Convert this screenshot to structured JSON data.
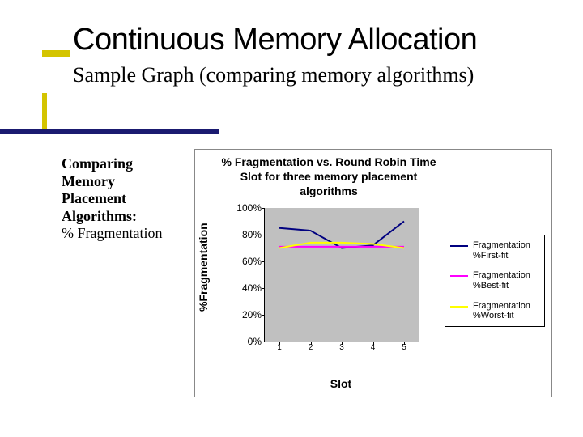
{
  "title": "Continuous Memory Allocation",
  "subtitle": "Sample Graph (comparing memory algorithms)",
  "side_caption": {
    "line1": "Comparing",
    "line2": "Memory",
    "line3": "Placement",
    "line4": "Algorithms:",
    "line5": "% Fragmentation"
  },
  "chart_data": {
    "type": "line",
    "title": "% Fragmentation vs. Round Robin Time Slot for three memory placement algorithms",
    "xlabel": "Slot",
    "ylabel": "%Fragmentation",
    "categories": [
      "1",
      "2",
      "3",
      "4",
      "5"
    ],
    "y_ticks": [
      "0%",
      "20%",
      "40%",
      "60%",
      "80%",
      "100%"
    ],
    "ylim": [
      0,
      100
    ],
    "series": [
      {
        "name": "Fragmentation %First-fit",
        "color": "#000080",
        "values": [
          85,
          83,
          70,
          72,
          90
        ]
      },
      {
        "name": "Fragmentation %Best-fit",
        "color": "#ff00ff",
        "values": [
          71,
          71,
          71,
          71,
          71
        ]
      },
      {
        "name": "Fragmentation %Worst-fit",
        "color": "#ffff00",
        "values": [
          70,
          74,
          74,
          73,
          70
        ]
      }
    ],
    "legend_position": "right",
    "grid": false,
    "plot_bg": "#c0c0c0"
  }
}
